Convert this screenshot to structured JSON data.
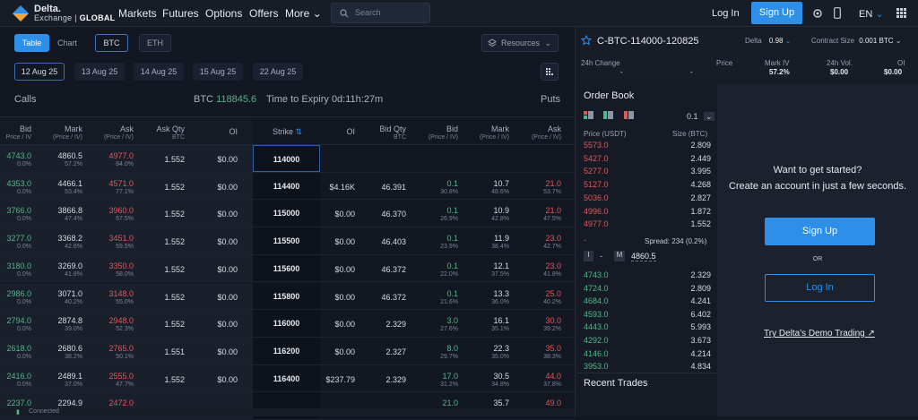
{
  "nav": {
    "brand_line1": "Delta.",
    "brand_line2a": "Exchange | ",
    "brand_line2b": "GLOBAL",
    "links": [
      "Markets",
      "Futures",
      "Options",
      "Offers",
      "More"
    ],
    "search_placeholder": "Search",
    "login": "Log In",
    "signup": "Sign Up",
    "lang": "EN"
  },
  "toolbar": {
    "table": "Table",
    "chart": "Chart",
    "btc": "BTC",
    "eth": "ETH",
    "resources": "Resources",
    "dates": [
      "12 Aug 25",
      "13 Aug 25",
      "14 Aug 25",
      "15 Aug 25",
      "22 Aug 25"
    ]
  },
  "chain": {
    "calls": "Calls",
    "puts": "Puts",
    "btc_label": "BTC",
    "btc_price": "118845.6",
    "expiry": "Time to Expiry 0d:11h:27m",
    "headers": {
      "bid": "Bid",
      "bid_sub": "Price / IV",
      "mark": "Mark",
      "mark_sub": "(Price / IV)",
      "ask": "Ask",
      "ask_sub": "(Price / IV)",
      "askqty": "Ask Qty",
      "askqty_sub": "BTC",
      "oi": "OI",
      "strike": "Strike",
      "oi2": "OI",
      "bidqty": "Bid Qty",
      "bidqty_sub": "BTC",
      "bid2": "Bid",
      "bid2_sub": "(Price / IV)",
      "mark2": "Mark",
      "mark2_sub": "(Price / IV)",
      "ask2": "Ask",
      "ask2_sub": "(Price / IV)"
    },
    "rows": [
      {
        "bid": "4743.0",
        "bidiv": "0.0%",
        "mark": "4860.5",
        "markiv": "57.2%",
        "ask": "4977.0",
        "askiv": "84.0%",
        "askqty": "1.552",
        "oi": "$0.00",
        "strike": "114000",
        "oi2": "",
        "bidqty": "",
        "pbid": "",
        "pbidiv": "",
        "pmark": "",
        "pmarkiv": "",
        "pask": "",
        "paskiv": ""
      },
      {
        "bid": "4353.0",
        "bidiv": "0.0%",
        "mark": "4466.1",
        "markiv": "53.4%",
        "ask": "4571.0",
        "askiv": "77.1%",
        "askqty": "1.552",
        "oi": "$0.00",
        "strike": "114400",
        "oi2": "$4.16K",
        "bidqty": "46.391",
        "pbid": "0.1",
        "pbidiv": "30.8%",
        "pmark": "10.7",
        "pmarkiv": "48.6%",
        "pask": "21.0",
        "paskiv": "53.7%"
      },
      {
        "bid": "3766.0",
        "bidiv": "0.0%",
        "mark": "3866.8",
        "markiv": "47.4%",
        "ask": "3960.0",
        "askiv": "67.5%",
        "askqty": "1.552",
        "oi": "$0.00",
        "strike": "115000",
        "oi2": "$0.00",
        "bidqty": "46.370",
        "pbid": "0.1",
        "pbidiv": "26.9%",
        "pmark": "10.9",
        "pmarkiv": "42.8%",
        "pask": "21.0",
        "paskiv": "47.5%"
      },
      {
        "bid": "3277.0",
        "bidiv": "0.0%",
        "mark": "3368.2",
        "markiv": "42.6%",
        "ask": "3451.0",
        "askiv": "59.5%",
        "askqty": "1.552",
        "oi": "$0.00",
        "strike": "115500",
        "oi2": "$0.00",
        "bidqty": "46.403",
        "pbid": "0.1",
        "pbidiv": "23.9%",
        "pmark": "11.9",
        "pmarkiv": "38.4%",
        "pask": "23.0",
        "paskiv": "42.7%"
      },
      {
        "bid": "3180.0",
        "bidiv": "0.0%",
        "mark": "3269.0",
        "markiv": "41.8%",
        "ask": "3350.0",
        "askiv": "58.0%",
        "askqty": "1.552",
        "oi": "$0.00",
        "strike": "115600",
        "oi2": "$0.00",
        "bidqty": "46.372",
        "pbid": "0.1",
        "pbidiv": "22.0%",
        "pmark": "12.1",
        "pmarkiv": "37.5%",
        "pask": "23.0",
        "paskiv": "41.8%"
      },
      {
        "bid": "2986.0",
        "bidiv": "0.0%",
        "mark": "3071.0",
        "markiv": "40.2%",
        "ask": "3148.0",
        "askiv": "55.0%",
        "askqty": "1.552",
        "oi": "$0.00",
        "strike": "115800",
        "oi2": "$0.00",
        "bidqty": "46.372",
        "pbid": "0.1",
        "pbidiv": "21.6%",
        "pmark": "13.3",
        "pmarkiv": "36.0%",
        "pask": "25.0",
        "paskiv": "40.2%"
      },
      {
        "bid": "2794.0",
        "bidiv": "0.0%",
        "mark": "2874.8",
        "markiv": "39.0%",
        "ask": "2948.0",
        "askiv": "52.3%",
        "askqty": "1.552",
        "oi": "$0.00",
        "strike": "116000",
        "oi2": "$0.00",
        "bidqty": "2.329",
        "pbid": "3.0",
        "pbidiv": "27.6%",
        "pmark": "16.1",
        "pmarkiv": "35.1%",
        "pask": "30.0",
        "paskiv": "39.2%"
      },
      {
        "bid": "2618.0",
        "bidiv": "0.0%",
        "mark": "2680.6",
        "markiv": "38.2%",
        "ask": "2765.0",
        "askiv": "50.1%",
        "askqty": "1.551",
        "oi": "$0.00",
        "strike": "116200",
        "oi2": "$0.00",
        "bidqty": "2.327",
        "pbid": "8.0",
        "pbidiv": "29.7%",
        "pmark": "22.3",
        "pmarkiv": "35.0%",
        "pask": "35.0",
        "paskiv": "38.3%"
      },
      {
        "bid": "2416.0",
        "bidiv": "0.0%",
        "mark": "2489.1",
        "markiv": "37.0%",
        "ask": "2555.0",
        "askiv": "47.7%",
        "askqty": "1.552",
        "oi": "$0.00",
        "strike": "116400",
        "oi2": "$237.79",
        "bidqty": "2.329",
        "pbid": "17.0",
        "pbidiv": "31.2%",
        "pmark": "30.5",
        "pmarkiv": "34.8%",
        "pask": "44.0",
        "paskiv": "37.8%"
      },
      {
        "bid": "2237.0",
        "bidiv": "",
        "mark": "2294.9",
        "markiv": "",
        "ask": "2472.0",
        "askiv": "",
        "askqty": "",
        "oi": "",
        "strike": "",
        "oi2": "",
        "bidqty": "",
        "pbid": "21.0",
        "pbidiv": "",
        "pmark": "35.7",
        "pmarkiv": "",
        "pask": "49.0",
        "paskiv": ""
      }
    ],
    "status": "Connected"
  },
  "contract": {
    "symbol": "C-BTC-114000-120825",
    "delta_label": "Delta",
    "delta_value": "0.98",
    "cs_label": "Contract Size",
    "cs_value": "0.001 BTC",
    "stats": [
      {
        "label": "24h Change",
        "value": "-"
      },
      {
        "label": "Price",
        "value": "-"
      },
      {
        "label": "Mark IV",
        "value": "57.2%"
      },
      {
        "label": "24h Vol.",
        "value": "$0.00"
      },
      {
        "label": "OI",
        "value": "$0.00"
      }
    ]
  },
  "orderbook": {
    "title": "Order Book",
    "tick": "0.1",
    "price_hdr": "Price (USDT)",
    "size_hdr": "Size (BTC)",
    "asks": [
      [
        "5573.0",
        "2.809"
      ],
      [
        "5427.0",
        "2.449"
      ],
      [
        "5277.0",
        "3.995"
      ],
      [
        "5127.0",
        "4.268"
      ],
      [
        "5036.0",
        "2.827"
      ],
      [
        "4996.0",
        "1.872"
      ],
      [
        "4977.0",
        "1.552"
      ]
    ],
    "spread_dash": "-",
    "spread": "Spread: 234 (0.2%)",
    "mark_label": "M",
    "mark_value": "4860.5",
    "bids": [
      [
        "4743.0",
        "2.329"
      ],
      [
        "4724.0",
        "2.809"
      ],
      [
        "4684.0",
        "4.241"
      ],
      [
        "4593.0",
        "6.402"
      ],
      [
        "4443.0",
        "5.993"
      ],
      [
        "4292.0",
        "3.673"
      ],
      [
        "4146.0",
        "4.214"
      ],
      [
        "3953.0",
        "4.834"
      ]
    ],
    "recent": "Recent Trades"
  },
  "cta": {
    "line1": "Want to get started?",
    "line2": "Create an account in just a few seconds.",
    "signup": "Sign Up",
    "or": "OR",
    "login": "Log In",
    "demo": "Try Delta's Demo Trading"
  }
}
